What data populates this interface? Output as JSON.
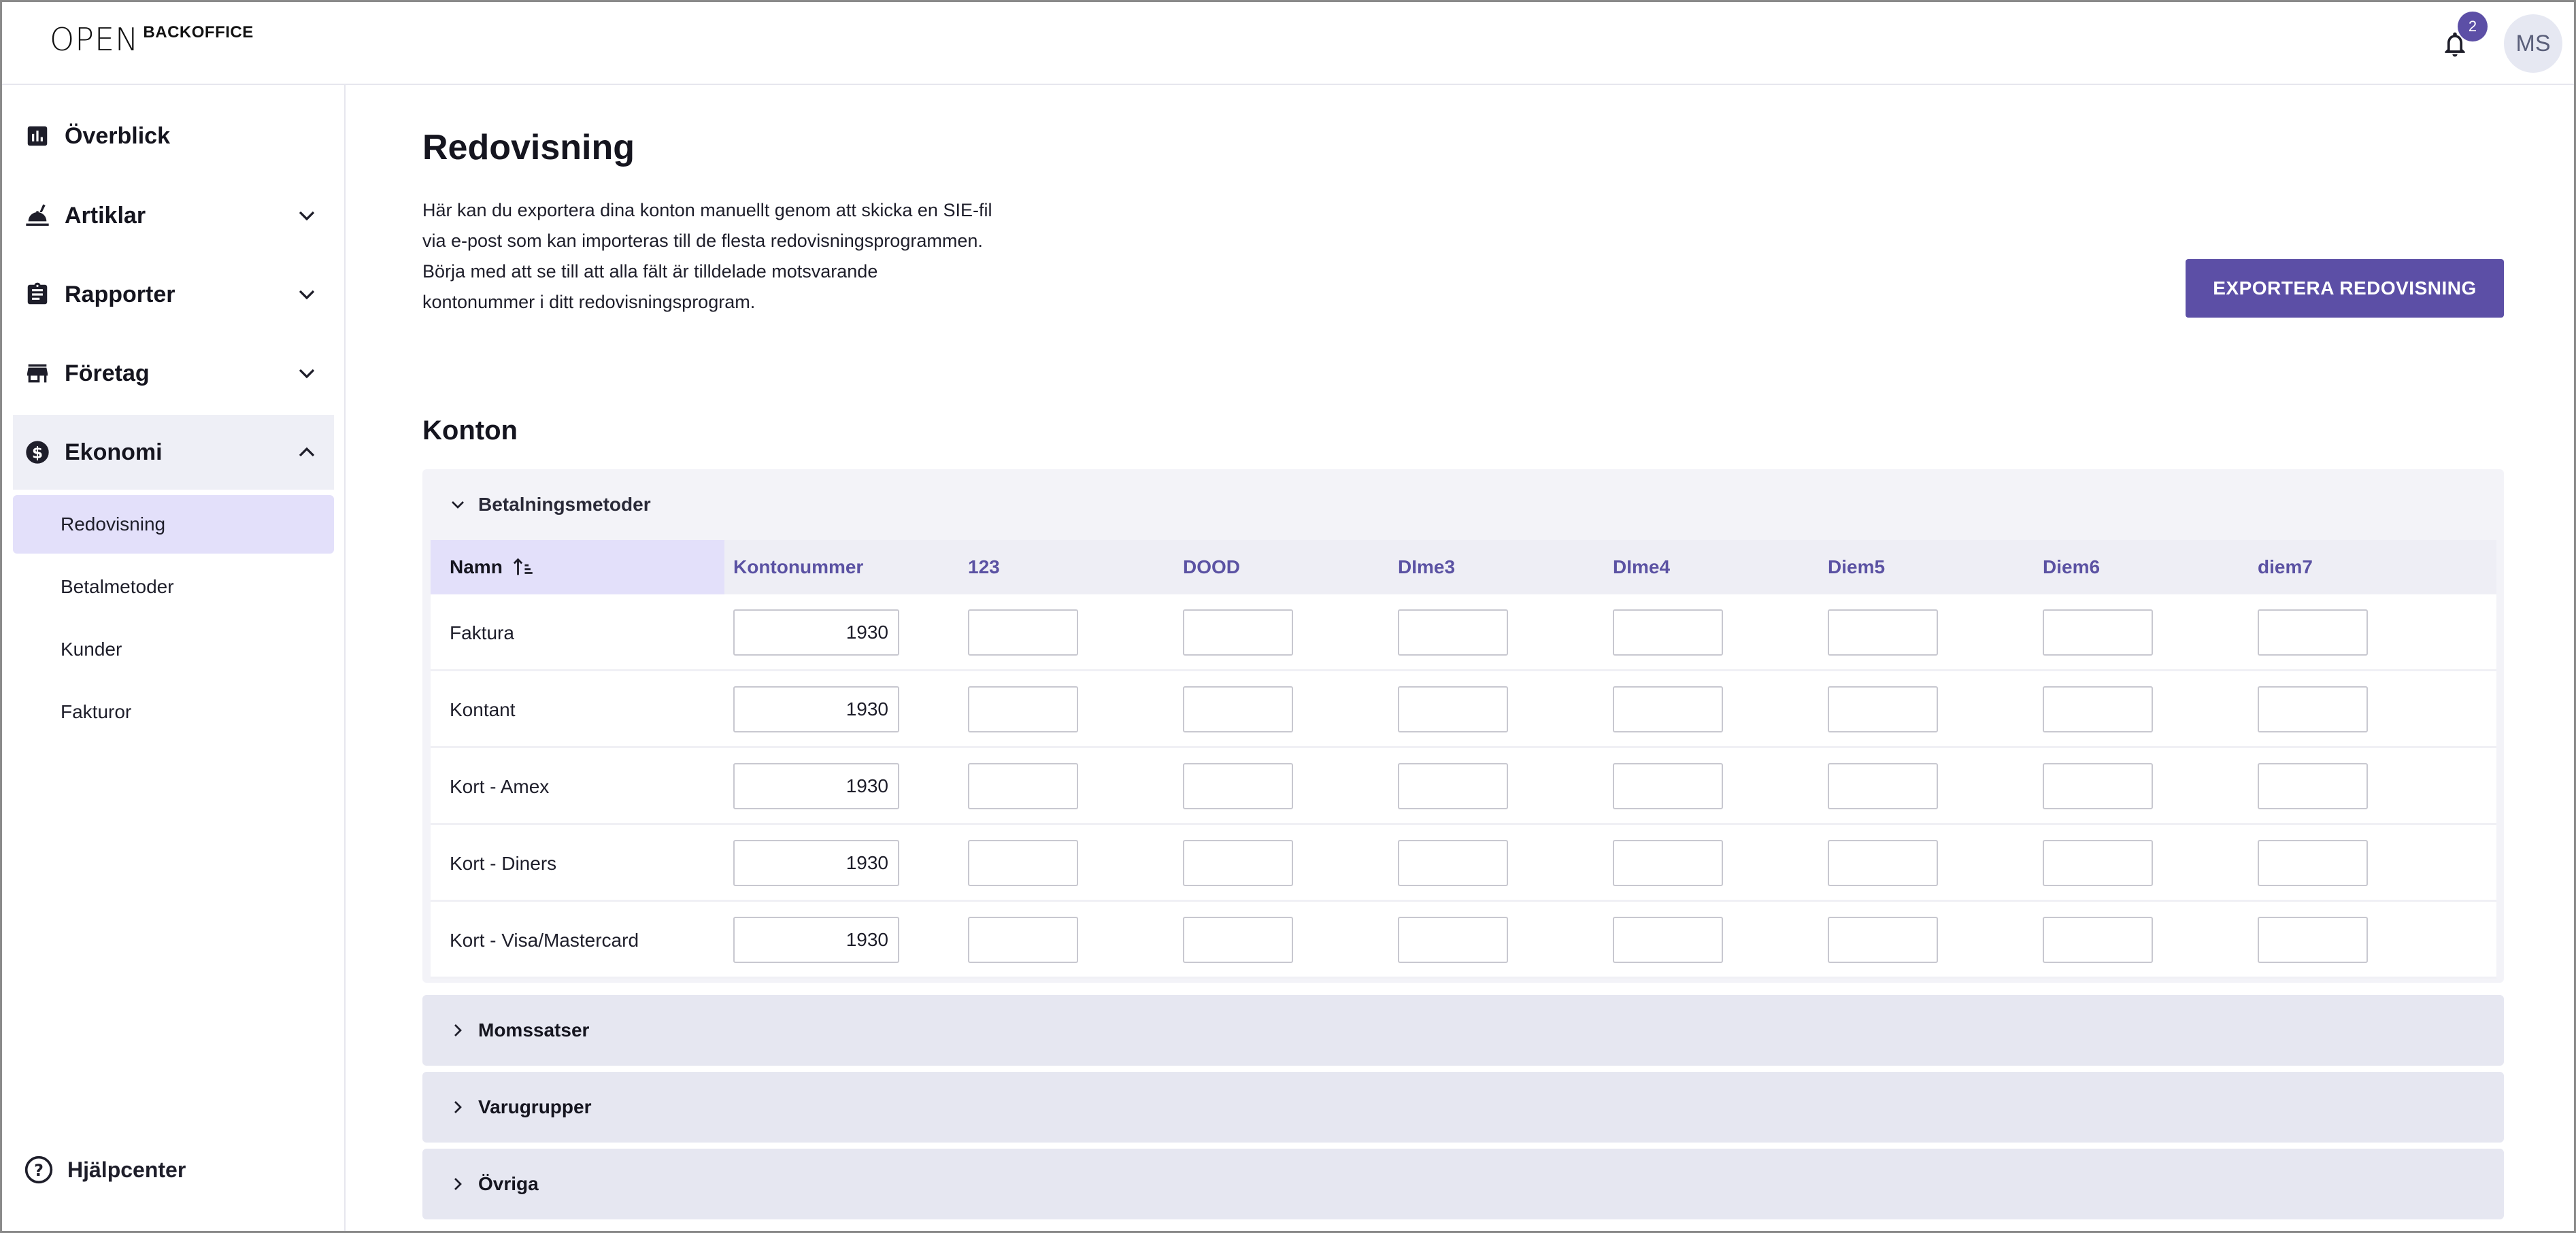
{
  "header": {
    "logo_mark": "OPEN",
    "logo_text": "BACKOFFICE",
    "notification_count": "2",
    "avatar_initials": "MS"
  },
  "sidebar": {
    "items": [
      {
        "label": "Överblick",
        "icon": "bar-chart-icon"
      },
      {
        "label": "Artiklar",
        "icon": "food-icon"
      },
      {
        "label": "Rapporter",
        "icon": "clipboard-icon"
      },
      {
        "label": "Företag",
        "icon": "store-icon"
      },
      {
        "label": "Ekonomi",
        "icon": "dollar-circle-icon"
      }
    ],
    "sub_items": [
      {
        "label": "Redovisning",
        "active": true
      },
      {
        "label": "Betalmetoder",
        "active": false
      },
      {
        "label": "Kunder",
        "active": false
      },
      {
        "label": "Fakturor",
        "active": false
      }
    ],
    "help_label": "Hjälpcenter"
  },
  "main": {
    "title": "Redovisning",
    "description": [
      "Här kan du exportera dina konton manuellt genom att skicka en SIE-fil",
      "via e-post som kan importeras till de flesta redovisningsprogrammen.",
      "Börja med att se till att alla fält är tilldelade motsvarande",
      "kontonummer i ditt redovisningsprogram."
    ],
    "export_button": "EXPORTERA REDOVISNING",
    "section_title": "Konton",
    "panel_title": "Betalningsmetoder",
    "columns": [
      "Namn",
      "Kontonummer",
      "123",
      "DOOD",
      "DIme3",
      "DIme4",
      "Diem5",
      "Diem6",
      "diem7"
    ],
    "rows": [
      {
        "name": "Faktura",
        "account": "1930"
      },
      {
        "name": "Kontant",
        "account": "1930"
      },
      {
        "name": "Kort - Amex",
        "account": "1930"
      },
      {
        "name": "Kort - Diners",
        "account": "1930"
      },
      {
        "name": "Kort - Visa/Mastercard",
        "account": "1930"
      }
    ],
    "collapsed_sections": [
      "Momssatser",
      "Varugrupper",
      "Övriga"
    ]
  },
  "colors": {
    "accent": "#5c4fa6",
    "active_bg": "#e3e0fa",
    "panel_bg": "#f3f3f8"
  }
}
